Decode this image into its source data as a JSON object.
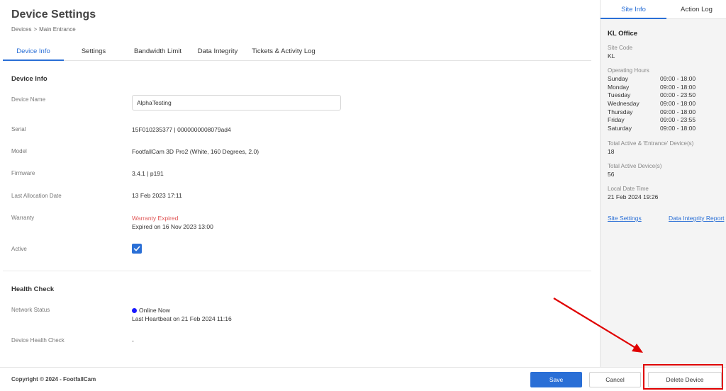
{
  "page": {
    "title": "Device Settings",
    "breadcrumb": [
      "Devices",
      "Main Entrance"
    ],
    "breadcrumb_sep": ">"
  },
  "tabs": [
    "Device Info",
    "Settings",
    "Bandwidth Limit",
    "Data Integrity",
    "Tickets & Activity Log"
  ],
  "device_info": {
    "section_title": "Device Info",
    "name_label": "Device Name",
    "name_value": "AlphaTesting",
    "serial_label": "Serial",
    "serial_value": "15F010235377 | 0000000008079ad4",
    "model_label": "Model",
    "model_value": "FootfallCam 3D Pro2 (White, 160 Degrees, 2.0)",
    "firmware_label": "Firmware",
    "firmware_value": "3.4.1 | p191",
    "alloc_label": "Last Allocation Date",
    "alloc_value": "13 Feb 2023 17:11",
    "warranty_label": "Warranty",
    "warranty_status": "Warranty Expired",
    "warranty_detail": "Expired on 16 Nov 2023 13:00",
    "active_label": "Active",
    "active_checked": true
  },
  "health_check": {
    "section_title": "Health Check",
    "network_label": "Network Status",
    "network_status": "Online Now",
    "network_status_color": "#1a1aff",
    "heartbeat": "Last Heartbeat on 21 Feb 2024 11:16",
    "device_health_label": "Device Health Check",
    "device_health_value": "-"
  },
  "footer": {
    "copyright": "Copyright © 2024 - FootfallCam",
    "save_label": "Save",
    "cancel_label": "Cancel",
    "delete_label": "Delete Device"
  },
  "side_panel": {
    "tabs": [
      "Site Info",
      "Action Log"
    ],
    "site_name": "KL Office",
    "site_code_label": "Site Code",
    "site_code": "KL",
    "hours_label": "Operating Hours",
    "hours": [
      {
        "day": "Sunday",
        "time": "09:00 - 18:00"
      },
      {
        "day": "Monday",
        "time": "09:00 - 18:00"
      },
      {
        "day": "Tuesday",
        "time": "00:00 - 23:50"
      },
      {
        "day": "Wednesday",
        "time": "09:00 - 18:00"
      },
      {
        "day": "Thursday",
        "time": "09:00 - 18:00"
      },
      {
        "day": "Friday",
        "time": "09:00 - 23:55"
      },
      {
        "day": "Saturday",
        "time": "09:00 - 18:00"
      }
    ],
    "total_entrance_label": "Total Active & 'Entrance' Device(s)",
    "total_entrance": "18",
    "total_active_label": "Total Active Device(s)",
    "total_active": "56",
    "local_time_label": "Local Date Time",
    "local_time": "21 Feb 2024 19:26",
    "site_settings_link": "Site Settings",
    "data_integrity_link": "Data Integrity Report"
  },
  "colors": {
    "accent": "#2a6fd6",
    "warning": "#e05555",
    "annotation": "#e00000"
  }
}
